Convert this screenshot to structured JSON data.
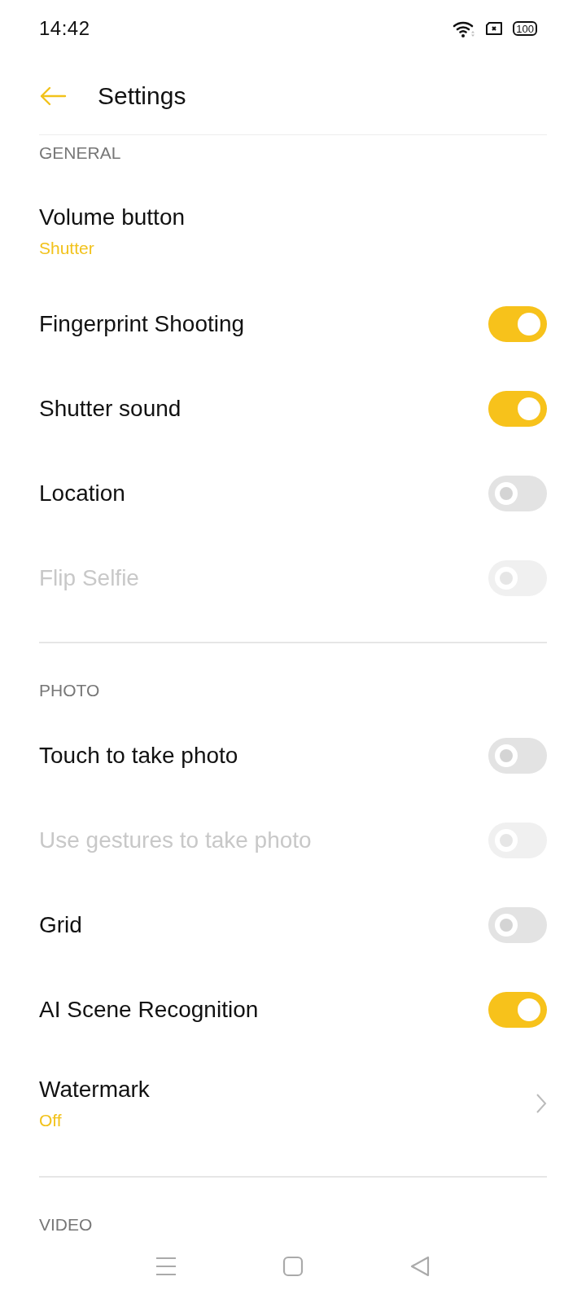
{
  "status_bar": {
    "time": "14:42",
    "battery": "100"
  },
  "header": {
    "title": "Settings"
  },
  "sections": [
    {
      "title": "GENERAL",
      "items": [
        {
          "kind": "value",
          "label": "Volume button",
          "value": "Shutter",
          "disabled": false
        },
        {
          "kind": "toggle",
          "label": "Fingerprint Shooting",
          "on": true,
          "disabled": false
        },
        {
          "kind": "toggle",
          "label": "Shutter sound",
          "on": true,
          "disabled": false
        },
        {
          "kind": "toggle",
          "label": "Location",
          "on": false,
          "disabled": false
        },
        {
          "kind": "toggle",
          "label": "Flip Selfie",
          "on": false,
          "disabled": true
        }
      ]
    },
    {
      "title": "PHOTO",
      "items": [
        {
          "kind": "toggle",
          "label": "Touch to take photo",
          "on": false,
          "disabled": false
        },
        {
          "kind": "toggle",
          "label": "Use gestures to take photo",
          "on": false,
          "disabled": true
        },
        {
          "kind": "toggle",
          "label": "Grid",
          "on": false,
          "disabled": false
        },
        {
          "kind": "toggle",
          "label": "AI Scene Recognition",
          "on": true,
          "disabled": false
        },
        {
          "kind": "link",
          "label": "Watermark",
          "value": "Off",
          "disabled": false
        }
      ]
    },
    {
      "title": "VIDEO"
    }
  ]
}
